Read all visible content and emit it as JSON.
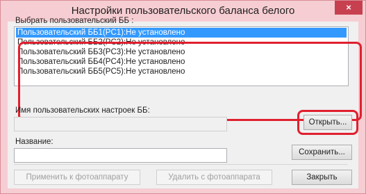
{
  "window": {
    "title": "Настройки пользовательского баланса белого",
    "close_label": "×"
  },
  "wb_list": {
    "label": "Выбрать пользовательский ББ :",
    "items": [
      "Пользовательский ББ1(PC1):Не установлено",
      "Пользовательский ББ2(PC2):Не установлено",
      "Пользовательский ББ3(PC3):Не установлено",
      "Пользовательский ББ4(PC4):Не установлено",
      "Пользовательский ББ5(PC5):Не установлено"
    ],
    "selected_index": 0
  },
  "settings_name": {
    "label": "Имя пользовательских настроек ББ:",
    "value": "",
    "open_label": "Открыть..."
  },
  "name": {
    "label": "Название:",
    "value": "",
    "save_label": "Сохранить..."
  },
  "footer": {
    "apply_label": "Применить к фотоаппарату",
    "delete_label": "Удалить с фотоаппарата",
    "close_label": "Закрыть"
  },
  "colors": {
    "highlight_ring": "#e0202f",
    "selection": "#3399ff",
    "title_bar": "#f6cdd2"
  }
}
